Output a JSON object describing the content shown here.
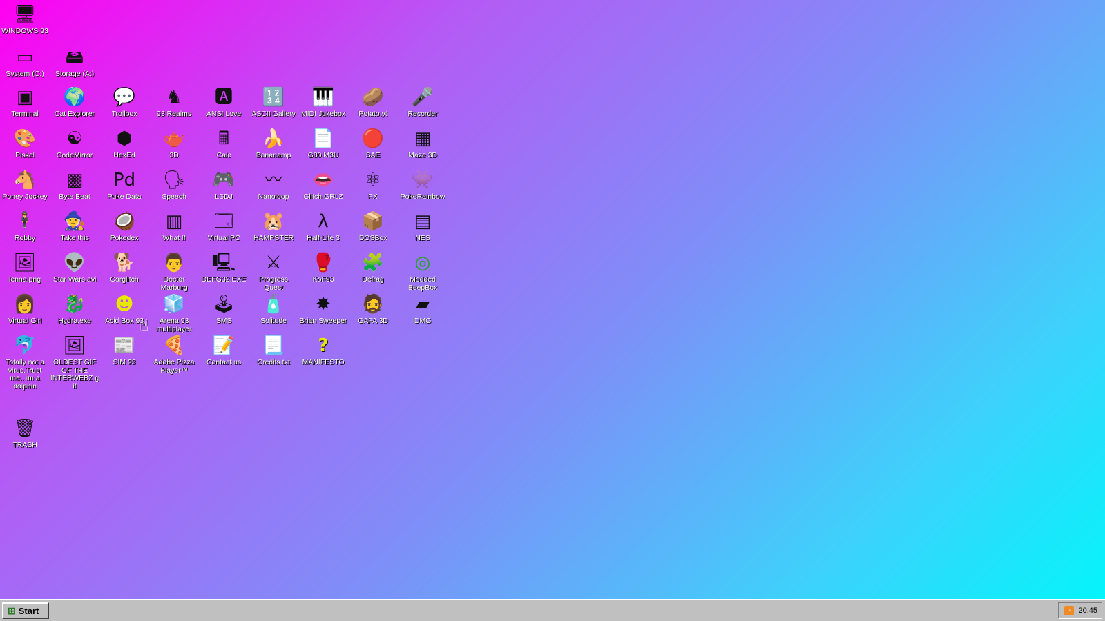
{
  "desktop": {
    "icons": [
      {
        "label": "WINDOWS 93",
        "icon": "computer-icon",
        "glyph": "🖥"
      },
      {
        "label": "System (C:)",
        "icon": "drive-icon",
        "glyph": "▭"
      },
      {
        "label": "Storage (A:)",
        "icon": "floppy-drives-icon",
        "glyph": "🖴"
      },
      {
        "label": "Terminal",
        "icon": "terminal-icon",
        "glyph": "▣"
      },
      {
        "label": "Cat Explorer",
        "icon": "globe-icon",
        "glyph": "🌍"
      },
      {
        "label": "Trollbox",
        "icon": "chat-icon",
        "glyph": "💬"
      },
      {
        "label": "93 Realms",
        "icon": "knight-icon",
        "glyph": "♞"
      },
      {
        "label": "ANSI Love",
        "icon": "ansi-icon",
        "glyph": "🅰"
      },
      {
        "label": "ASCII Gallery",
        "icon": "ascii-icon",
        "glyph": "🔢"
      },
      {
        "label": "MIDI Jukebox",
        "icon": "piano-icon",
        "glyph": "🎹"
      },
      {
        "label": "Potato.yt",
        "icon": "potato-icon",
        "glyph": "🥔"
      },
      {
        "label": "Recorder",
        "icon": "microphone-icon",
        "glyph": "🎤"
      },
      {
        "label": "Piskel",
        "icon": "palette-icon",
        "glyph": "🎨"
      },
      {
        "label": "CodeMirror",
        "icon": "codemirror-icon",
        "glyph": "☯"
      },
      {
        "label": "HexEd",
        "icon": "cube-icon",
        "glyph": "⬢"
      },
      {
        "label": "3D",
        "icon": "teapot-icon",
        "glyph": "🫖"
      },
      {
        "label": "Calc",
        "icon": "calculator-icon",
        "glyph": "🖩"
      },
      {
        "label": "Bananamp",
        "icon": "banana-icon",
        "glyph": "🍌"
      },
      {
        "label": "G80.M3U",
        "icon": "playlist-icon",
        "glyph": "📄"
      },
      {
        "label": "SAE",
        "icon": "checkered-ball-icon",
        "glyph": "🔴"
      },
      {
        "label": "Maze 3D",
        "icon": "maze-icon",
        "glyph": "▦"
      },
      {
        "label": "Poney Jockey",
        "icon": "pony-icon",
        "glyph": "🐴"
      },
      {
        "label": "Byte Beat",
        "icon": "waveform-icon",
        "glyph": "▩"
      },
      {
        "label": "Puke Data",
        "icon": "pd-icon",
        "glyph": "Pd"
      },
      {
        "label": "Speech",
        "icon": "speech-icon",
        "glyph": "🗣"
      },
      {
        "label": "LSDJ",
        "icon": "lsdj-icon",
        "glyph": "🎮"
      },
      {
        "label": "Nanoloop",
        "icon": "nanoloop-icon",
        "glyph": "〰"
      },
      {
        "label": "Glitch GRLZ",
        "icon": "lips-icon",
        "glyph": "👄"
      },
      {
        "label": "FX",
        "icon": "atom-icon",
        "glyph": "⚛"
      },
      {
        "label": "PokeRainbow",
        "icon": "pokerainbow-icon",
        "glyph": "👾"
      },
      {
        "label": "Robby",
        "icon": "stick-figure-icon",
        "glyph": "🕴"
      },
      {
        "label": "Take this",
        "icon": "take-this-icon",
        "glyph": "🧙"
      },
      {
        "label": "Pokedex",
        "icon": "pokedex-icon",
        "glyph": "🥥"
      },
      {
        "label": "What If",
        "icon": "what-if-icon",
        "glyph": "▥"
      },
      {
        "label": "Virtual PC",
        "icon": "window-icon",
        "glyph": "🗔"
      },
      {
        "label": "HAMPSTER",
        "icon": "hamster-icon",
        "glyph": "🐹"
      },
      {
        "label": "Half-Life 3",
        "icon": "lambda-icon",
        "glyph": "λ"
      },
      {
        "label": "DOSBox",
        "icon": "dosbox-icon",
        "glyph": "📦"
      },
      {
        "label": "NES",
        "icon": "nes-icon",
        "glyph": "▤"
      },
      {
        "label": "lenna.png",
        "icon": "image-file-icon",
        "glyph": "🖼"
      },
      {
        "label": "Star Wars.avi",
        "icon": "yoda-icon",
        "glyph": "👽"
      },
      {
        "label": "Corglitch",
        "icon": "corgi-icon",
        "glyph": "🐕"
      },
      {
        "label": "Doctor Marburg",
        "icon": "doctor-icon",
        "glyph": "👨"
      },
      {
        "label": "DEFG32.EXE",
        "icon": "monitor-icon",
        "glyph": "🖳"
      },
      {
        "label": "Progress Quest",
        "icon": "swords-icon",
        "glyph": "⚔"
      },
      {
        "label": "KoF93",
        "icon": "fighter-icon",
        "glyph": "🥊"
      },
      {
        "label": "Defrag",
        "icon": "defrag-icon",
        "glyph": "🧩"
      },
      {
        "label": "Modded BeepBox",
        "icon": "ring-icon",
        "glyph": "◎"
      },
      {
        "label": "Virtual Girl",
        "icon": "virtual-girl-icon",
        "glyph": "👩"
      },
      {
        "label": "Hydra.exe",
        "icon": "dragon-icon",
        "glyph": "🐉"
      },
      {
        "label": "Acid Box 93",
        "icon": "smiley-icon",
        "glyph": "☻"
      },
      {
        "label": "Arena 93 multiplayer",
        "icon": "color-cube-icon",
        "glyph": "🧊"
      },
      {
        "label": "SMS",
        "icon": "sms-console-icon",
        "glyph": "🕹"
      },
      {
        "label": "Solitude",
        "icon": "bottle-icon",
        "glyph": "🧴"
      },
      {
        "label": "Brian Sweeper",
        "icon": "mine-icon",
        "glyph": "✸"
      },
      {
        "label": "GAFA 3D",
        "icon": "gafa-icon",
        "glyph": "🧔"
      },
      {
        "label": "DMG",
        "icon": "gameboy-icon",
        "glyph": "▰"
      },
      {
        "label": "Totally not a virus.Trust me...im a dolphin",
        "icon": "dolphin-icon",
        "glyph": "🐬"
      },
      {
        "label": "OLDEST GIF OF THE INTERWEBZ.gif",
        "icon": "gif-file-icon",
        "glyph": "🖼"
      },
      {
        "label": "SIM 93",
        "icon": "sim-icon",
        "glyph": "📰"
      },
      {
        "label": "Adobe Pizza Player™",
        "icon": "pizza-icon",
        "glyph": "🍕"
      },
      {
        "label": "Contact us",
        "icon": "contact-icon",
        "glyph": "📝"
      },
      {
        "label": "Credits.txt",
        "icon": "text-file-icon",
        "glyph": "📃"
      },
      {
        "label": "MANIFESTO",
        "icon": "question-icon",
        "glyph": "?"
      },
      {
        "label": "TRASH",
        "icon": "trash-icon",
        "glyph": "🗑"
      }
    ]
  },
  "taskbar": {
    "start_label": "Start",
    "clock": "20:45"
  },
  "colors": {
    "gradient_start": "#ff00f2",
    "gradient_end": "#00f7fb",
    "taskbar": "#c0c0c0",
    "rss": "#f08a24"
  }
}
